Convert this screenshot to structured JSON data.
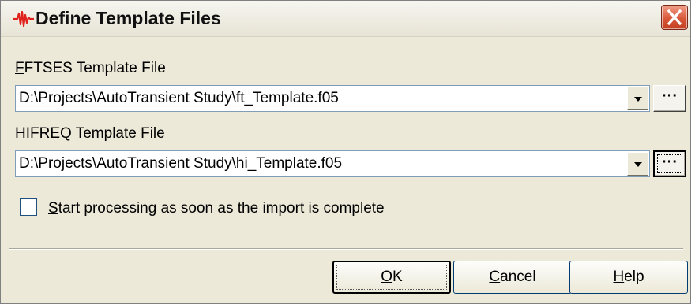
{
  "window": {
    "title": "Define Template Files",
    "icon": "waveform-icon",
    "close_icon": "close-icon",
    "close_color": "#d9583a"
  },
  "fftses": {
    "label_accel": "F",
    "label_rest": "FTSES Template File",
    "value": "D:\\Projects\\AutoTransient Study\\ft_Template.f05",
    "browse_label": "···"
  },
  "hifreq": {
    "label_accel": "H",
    "label_rest": "IFREQ Template File",
    "value": "D:\\Projects\\AutoTransient Study\\hi_Template.f05",
    "browse_label": "···"
  },
  "options": {
    "start_processing_accel": "S",
    "start_processing_rest": "tart processing as soon as the import is complete",
    "start_processing_checked": false
  },
  "buttons": {
    "ok_accel": "O",
    "ok_rest": "K",
    "cancel_accel": "C",
    "cancel_rest": "ancel",
    "help_accel": "H",
    "help_rest": "elp"
  }
}
